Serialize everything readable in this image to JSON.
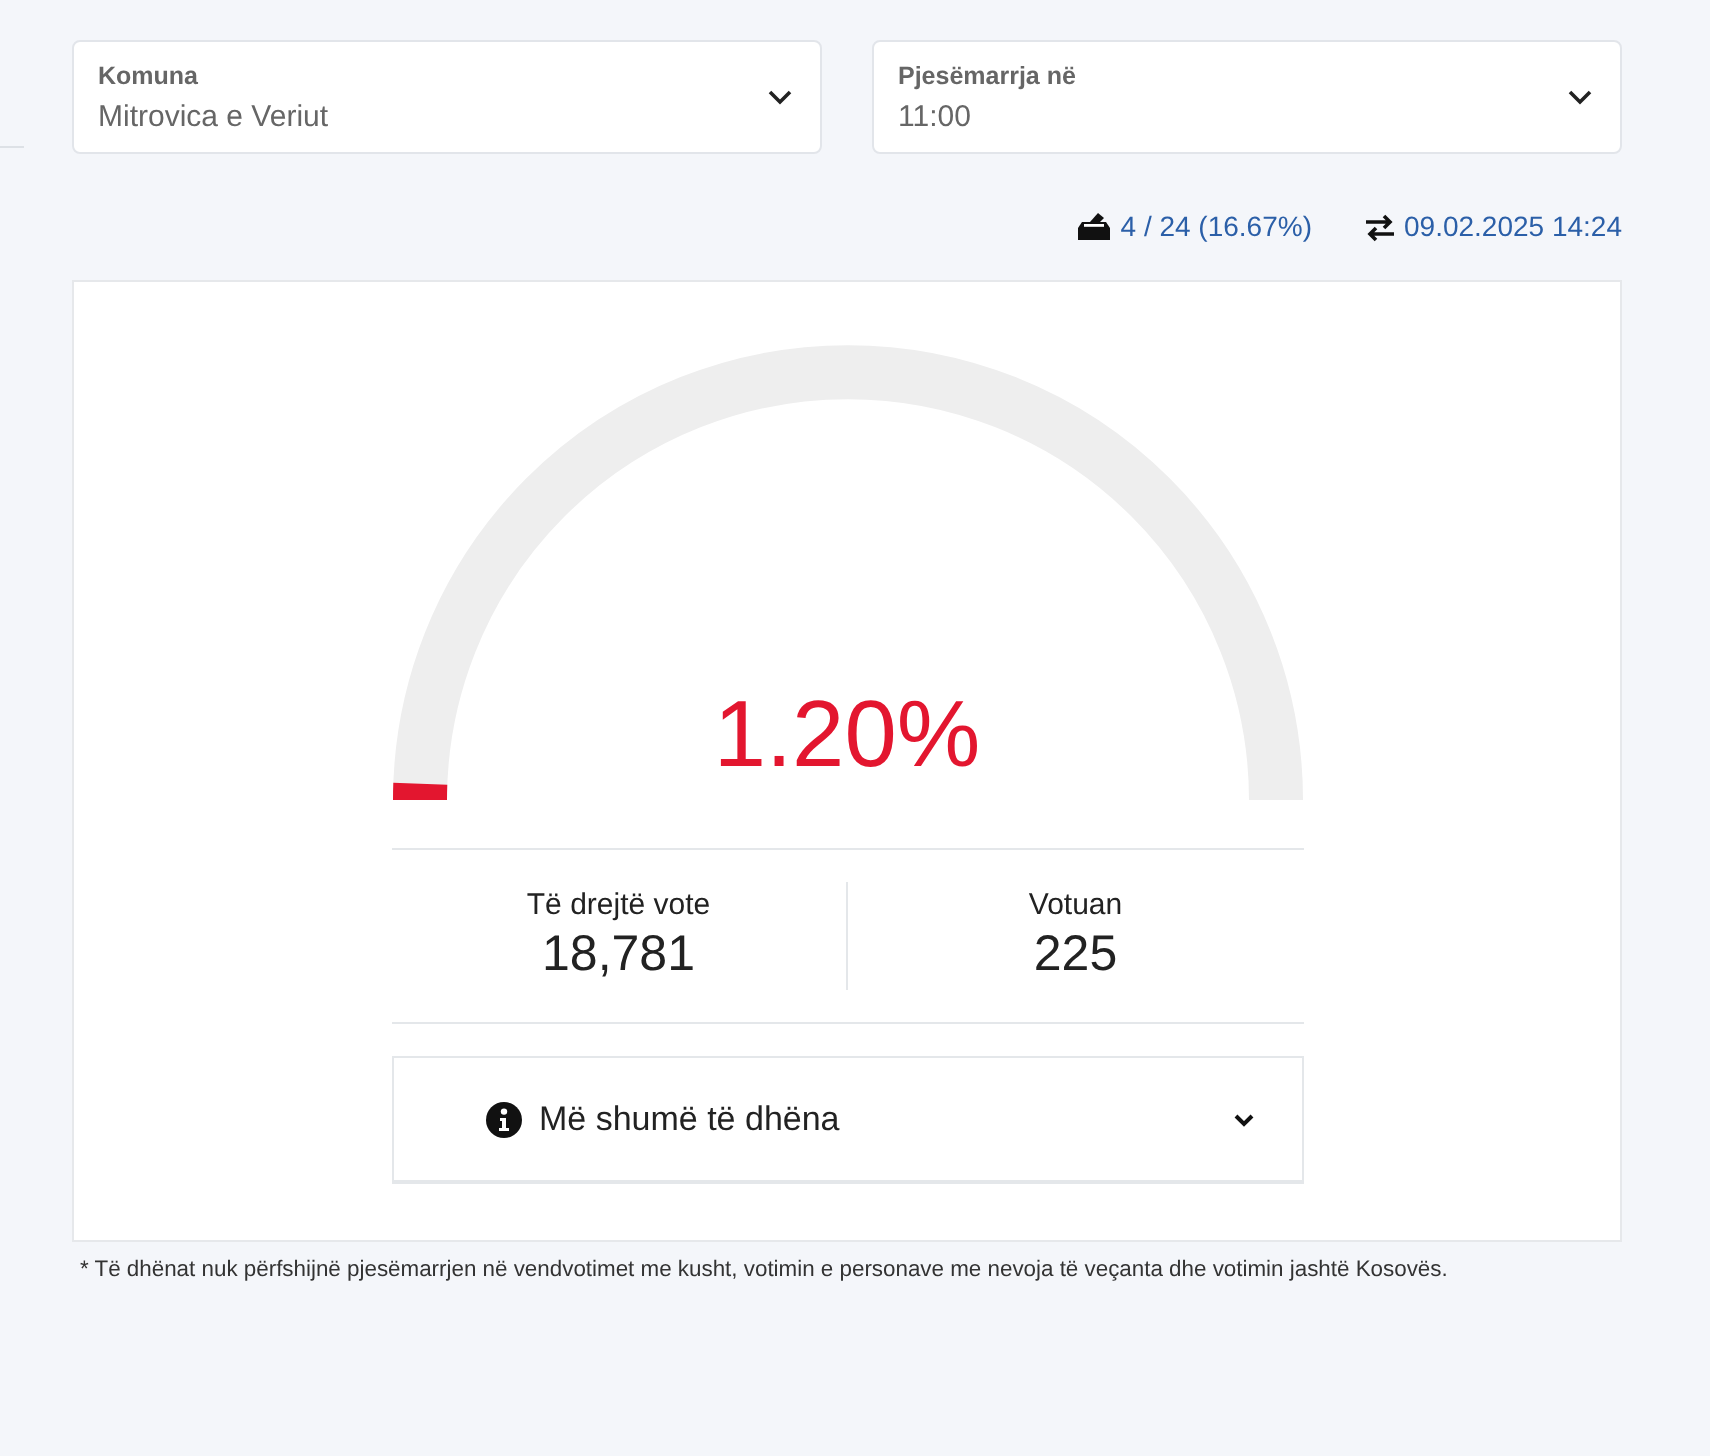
{
  "filters": [
    {
      "label": "Komuna",
      "value": "Mitrovica e Veriut"
    },
    {
      "label": "Pjesëmarrja në",
      "value": "11:00"
    }
  ],
  "status": {
    "stations": "4 / 24 (16.67%)",
    "updated": "09.02.2025 14:24"
  },
  "gauge": {
    "level": 0.012,
    "reading": "1.20%"
  },
  "stats": [
    {
      "label": "Të drejtë vote",
      "value": "18,781"
    },
    {
      "label": "Votuan",
      "value": "225"
    }
  ],
  "more": {
    "label": "Më shumë të dhëna",
    "expanded": false
  },
  "footnote": "* Të dhënat nuk përfshijnë pjesëmarrjen në vendvotimet me kusht, votimin e personave me nevoja të veçanta dhe votimin jashtë Kosovës."
}
